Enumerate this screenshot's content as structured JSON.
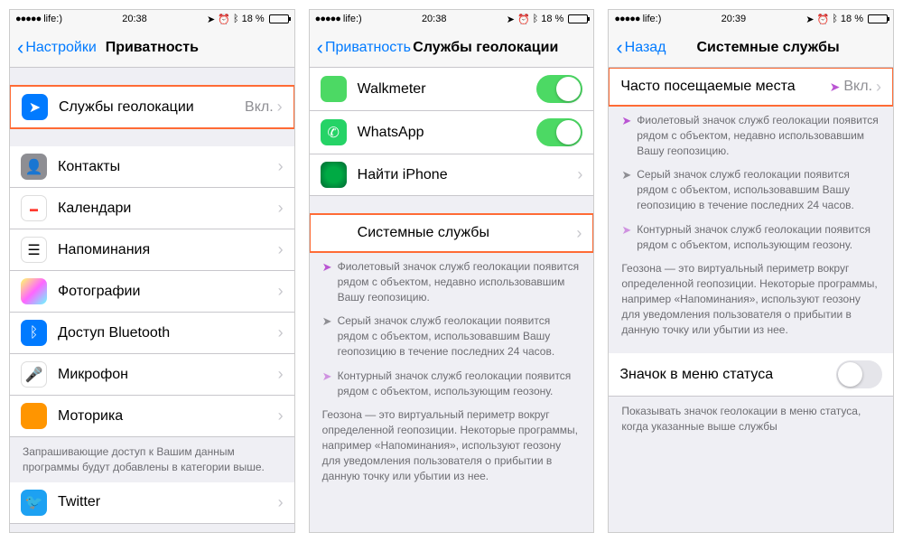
{
  "status": {
    "carrier": "life:)",
    "time1": "20:38",
    "time2": "20:39",
    "pct": "18 %"
  },
  "s1": {
    "back": "Настройки",
    "title": "Приватность",
    "rows": [
      {
        "label": "Службы геолокации",
        "value": "Вкл.",
        "hl": true
      },
      {
        "label": "Контакты"
      },
      {
        "label": "Календари"
      },
      {
        "label": "Напоминания"
      },
      {
        "label": "Фотографии"
      },
      {
        "label": "Доступ Bluetooth"
      },
      {
        "label": "Микрофон"
      },
      {
        "label": "Моторика"
      }
    ],
    "note": "Запрашивающие доступ к Вашим данным программы будут добавлены в категории выше.",
    "twitter": "Twitter"
  },
  "s2": {
    "back": "Приватность",
    "title": "Службы геолокации",
    "apps": [
      {
        "label": "Walkmeter"
      },
      {
        "label": "WhatsApp"
      },
      {
        "label": "Найти iPhone"
      }
    ],
    "system": "Системные службы",
    "legends": [
      "Фиолетовый значок служб геолокации появится рядом с объектом, недавно использовавшим Вашу геопозицию.",
      "Серый значок служб геолокации появится рядом с объектом, использовавшим Вашу геопозицию в течение последних 24 часов.",
      "Контурный значок служб геолокации появится рядом с объектом, использующим геозону."
    ],
    "geo": "Геозона — это виртуальный периметр вокруг определенной геопозиции. Некоторые программы, например «Напоминания», используют геозону для уведомления пользователя о прибытии в данную точку или убытии из нее."
  },
  "s3": {
    "back": "Назад",
    "title": "Системные службы",
    "freq": "Часто посещаемые места",
    "freqval": "Вкл.",
    "legends": [
      "Фиолетовый значок служб геолокации появится рядом с объектом, недавно использовавшим Вашу геопозицию.",
      "Серый значок служб геолокации появится рядом с объектом, использовавшим Вашу геопозицию в течение последних 24 часов.",
      "Контурный значок служб геолокации появится рядом с объектом, использующим геозону."
    ],
    "geo": "Геозона — это виртуальный периметр вокруг определенной геопозиции. Некоторые программы, например «Напоминания», используют геозону для уведомления пользователя о прибытии в данную точку или убытии из нее.",
    "statusicon": "Значок в меню статуса",
    "statusnote": "Показывать значок геолокации в меню статуса, когда указанные выше службы"
  }
}
